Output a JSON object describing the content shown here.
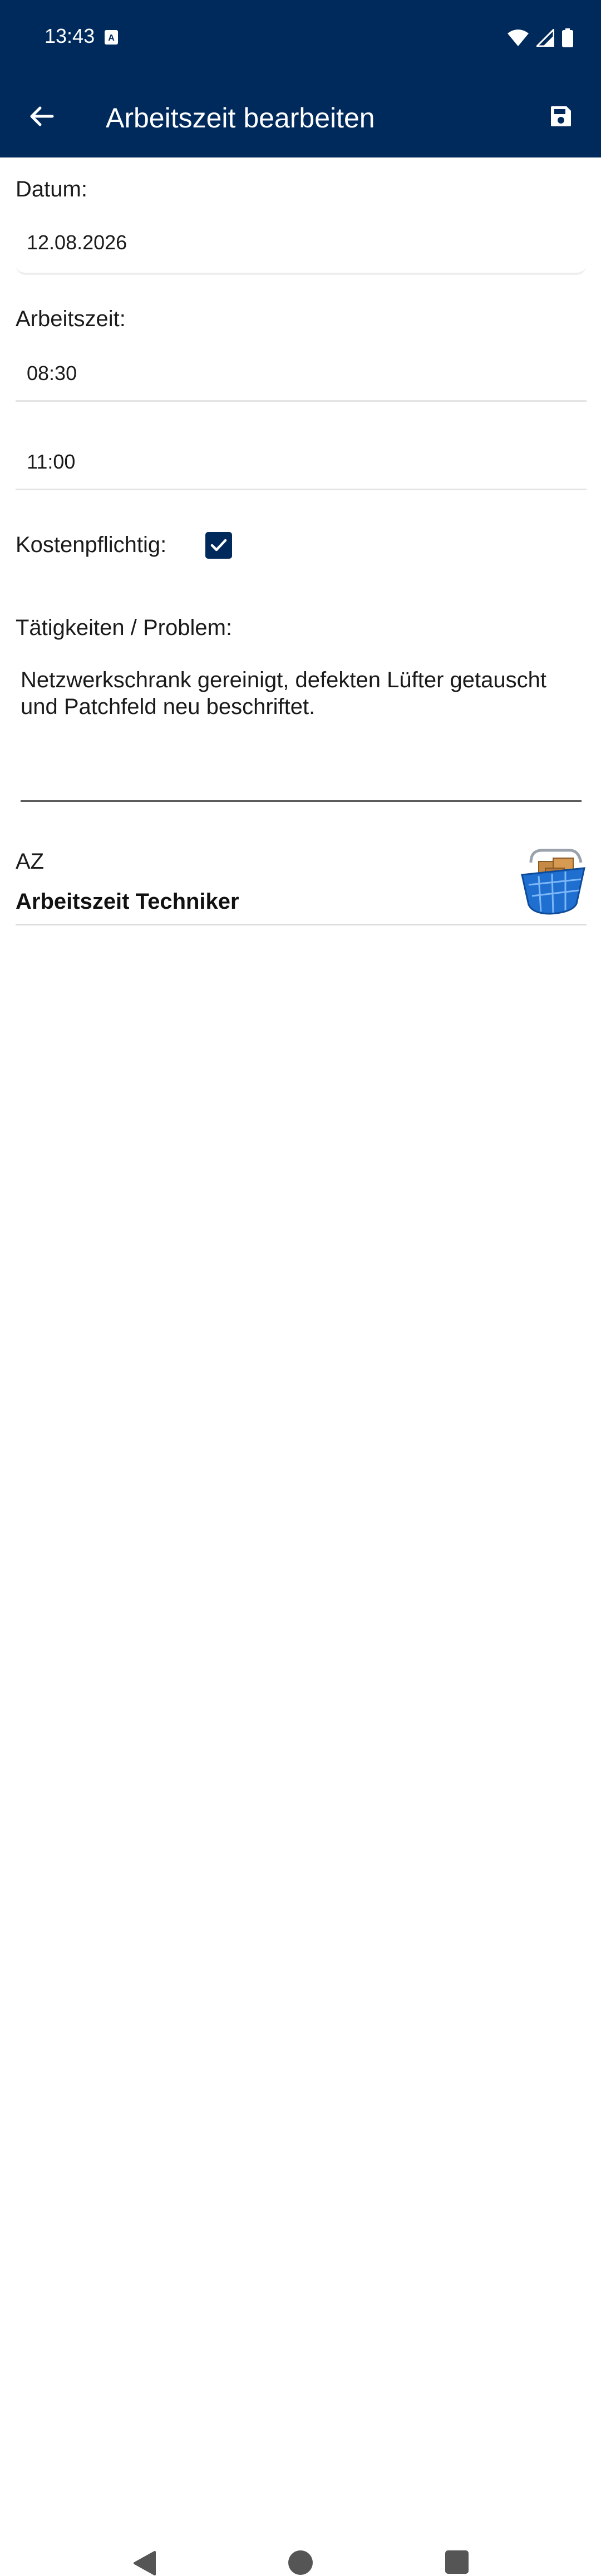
{
  "status_bar": {
    "time": "13:43"
  },
  "app_bar": {
    "title": "Arbeitszeit bearbeiten",
    "back_icon": "arrow-left-icon",
    "save_icon": "floppy-disk-icon"
  },
  "form": {
    "date_label": "Datum:",
    "date_value": "12.08.2026",
    "worktime_label": "Arbeitszeit:",
    "start_time": "08:30",
    "end_time": "11:00",
    "billable_label": "Kostenpflichtig:",
    "billable_checked": true,
    "activities_label": "Tätigkeiten / Problem:",
    "activities_text": "Netzwerkschrank gereinigt, defekten Lüfter getauscht und Patchfeld neu beschriftet."
  },
  "product": {
    "code": "AZ",
    "name": "Arbeitszeit Techniker",
    "icon": "shopping-basket-icon"
  },
  "colors": {
    "primary": "#002a5c",
    "background": "#ffffff"
  }
}
